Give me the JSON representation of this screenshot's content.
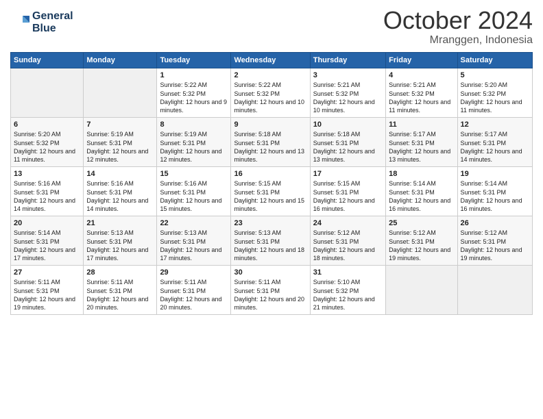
{
  "logo": {
    "line1": "General",
    "line2": "Blue"
  },
  "title": "October 2024",
  "location": "Mranggen, Indonesia",
  "days_of_week": [
    "Sunday",
    "Monday",
    "Tuesday",
    "Wednesday",
    "Thursday",
    "Friday",
    "Saturday"
  ],
  "weeks": [
    [
      {
        "day": "",
        "empty": true
      },
      {
        "day": "",
        "empty": true
      },
      {
        "day": "1",
        "sunrise": "Sunrise: 5:22 AM",
        "sunset": "Sunset: 5:32 PM",
        "daylight": "Daylight: 12 hours and 9 minutes."
      },
      {
        "day": "2",
        "sunrise": "Sunrise: 5:22 AM",
        "sunset": "Sunset: 5:32 PM",
        "daylight": "Daylight: 12 hours and 10 minutes."
      },
      {
        "day": "3",
        "sunrise": "Sunrise: 5:21 AM",
        "sunset": "Sunset: 5:32 PM",
        "daylight": "Daylight: 12 hours and 10 minutes."
      },
      {
        "day": "4",
        "sunrise": "Sunrise: 5:21 AM",
        "sunset": "Sunset: 5:32 PM",
        "daylight": "Daylight: 12 hours and 11 minutes."
      },
      {
        "day": "5",
        "sunrise": "Sunrise: 5:20 AM",
        "sunset": "Sunset: 5:32 PM",
        "daylight": "Daylight: 12 hours and 11 minutes."
      }
    ],
    [
      {
        "day": "6",
        "sunrise": "Sunrise: 5:20 AM",
        "sunset": "Sunset: 5:32 PM",
        "daylight": "Daylight: 12 hours and 11 minutes."
      },
      {
        "day": "7",
        "sunrise": "Sunrise: 5:19 AM",
        "sunset": "Sunset: 5:31 PM",
        "daylight": "Daylight: 12 hours and 12 minutes."
      },
      {
        "day": "8",
        "sunrise": "Sunrise: 5:19 AM",
        "sunset": "Sunset: 5:31 PM",
        "daylight": "Daylight: 12 hours and 12 minutes."
      },
      {
        "day": "9",
        "sunrise": "Sunrise: 5:18 AM",
        "sunset": "Sunset: 5:31 PM",
        "daylight": "Daylight: 12 hours and 13 minutes."
      },
      {
        "day": "10",
        "sunrise": "Sunrise: 5:18 AM",
        "sunset": "Sunset: 5:31 PM",
        "daylight": "Daylight: 12 hours and 13 minutes."
      },
      {
        "day": "11",
        "sunrise": "Sunrise: 5:17 AM",
        "sunset": "Sunset: 5:31 PM",
        "daylight": "Daylight: 12 hours and 13 minutes."
      },
      {
        "day": "12",
        "sunrise": "Sunrise: 5:17 AM",
        "sunset": "Sunset: 5:31 PM",
        "daylight": "Daylight: 12 hours and 14 minutes."
      }
    ],
    [
      {
        "day": "13",
        "sunrise": "Sunrise: 5:16 AM",
        "sunset": "Sunset: 5:31 PM",
        "daylight": "Daylight: 12 hours and 14 minutes."
      },
      {
        "day": "14",
        "sunrise": "Sunrise: 5:16 AM",
        "sunset": "Sunset: 5:31 PM",
        "daylight": "Daylight: 12 hours and 14 minutes."
      },
      {
        "day": "15",
        "sunrise": "Sunrise: 5:16 AM",
        "sunset": "Sunset: 5:31 PM",
        "daylight": "Daylight: 12 hours and 15 minutes."
      },
      {
        "day": "16",
        "sunrise": "Sunrise: 5:15 AM",
        "sunset": "Sunset: 5:31 PM",
        "daylight": "Daylight: 12 hours and 15 minutes."
      },
      {
        "day": "17",
        "sunrise": "Sunrise: 5:15 AM",
        "sunset": "Sunset: 5:31 PM",
        "daylight": "Daylight: 12 hours and 16 minutes."
      },
      {
        "day": "18",
        "sunrise": "Sunrise: 5:14 AM",
        "sunset": "Sunset: 5:31 PM",
        "daylight": "Daylight: 12 hours and 16 minutes."
      },
      {
        "day": "19",
        "sunrise": "Sunrise: 5:14 AM",
        "sunset": "Sunset: 5:31 PM",
        "daylight": "Daylight: 12 hours and 16 minutes."
      }
    ],
    [
      {
        "day": "20",
        "sunrise": "Sunrise: 5:14 AM",
        "sunset": "Sunset: 5:31 PM",
        "daylight": "Daylight: 12 hours and 17 minutes."
      },
      {
        "day": "21",
        "sunrise": "Sunrise: 5:13 AM",
        "sunset": "Sunset: 5:31 PM",
        "daylight": "Daylight: 12 hours and 17 minutes."
      },
      {
        "day": "22",
        "sunrise": "Sunrise: 5:13 AM",
        "sunset": "Sunset: 5:31 PM",
        "daylight": "Daylight: 12 hours and 17 minutes."
      },
      {
        "day": "23",
        "sunrise": "Sunrise: 5:13 AM",
        "sunset": "Sunset: 5:31 PM",
        "daylight": "Daylight: 12 hours and 18 minutes."
      },
      {
        "day": "24",
        "sunrise": "Sunrise: 5:12 AM",
        "sunset": "Sunset: 5:31 PM",
        "daylight": "Daylight: 12 hours and 18 minutes."
      },
      {
        "day": "25",
        "sunrise": "Sunrise: 5:12 AM",
        "sunset": "Sunset: 5:31 PM",
        "daylight": "Daylight: 12 hours and 19 minutes."
      },
      {
        "day": "26",
        "sunrise": "Sunrise: 5:12 AM",
        "sunset": "Sunset: 5:31 PM",
        "daylight": "Daylight: 12 hours and 19 minutes."
      }
    ],
    [
      {
        "day": "27",
        "sunrise": "Sunrise: 5:11 AM",
        "sunset": "Sunset: 5:31 PM",
        "daylight": "Daylight: 12 hours and 19 minutes."
      },
      {
        "day": "28",
        "sunrise": "Sunrise: 5:11 AM",
        "sunset": "Sunset: 5:31 PM",
        "daylight": "Daylight: 12 hours and 20 minutes."
      },
      {
        "day": "29",
        "sunrise": "Sunrise: 5:11 AM",
        "sunset": "Sunset: 5:31 PM",
        "daylight": "Daylight: 12 hours and 20 minutes."
      },
      {
        "day": "30",
        "sunrise": "Sunrise: 5:11 AM",
        "sunset": "Sunset: 5:31 PM",
        "daylight": "Daylight: 12 hours and 20 minutes."
      },
      {
        "day": "31",
        "sunrise": "Sunrise: 5:10 AM",
        "sunset": "Sunset: 5:32 PM",
        "daylight": "Daylight: 12 hours and 21 minutes."
      },
      {
        "day": "",
        "empty": true
      },
      {
        "day": "",
        "empty": true
      }
    ]
  ]
}
